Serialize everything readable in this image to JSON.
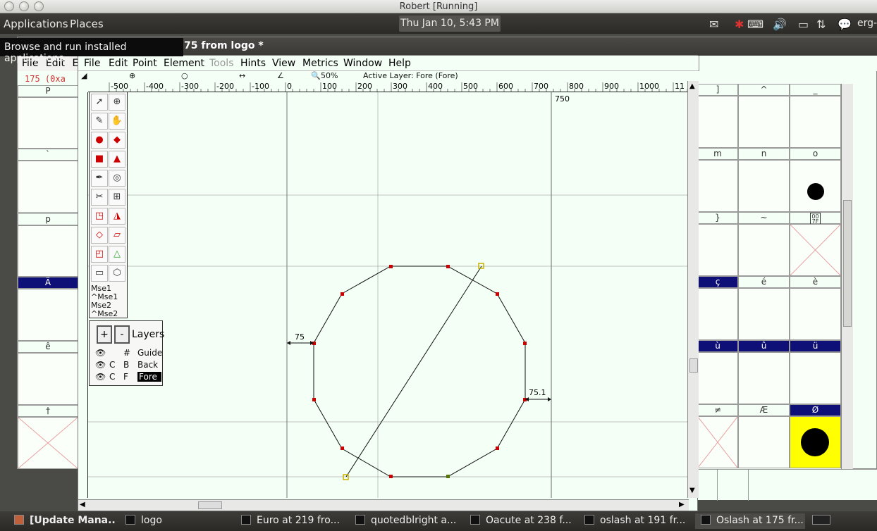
{
  "window_title": "Robert [Running]",
  "panel": {
    "applications": "Applications",
    "places": "Places",
    "clock": "Thu Jan 10,  5:43 PM",
    "user": "erg-"
  },
  "tooltip": "Browse and run installed applications",
  "fontview": {
    "title": "75 from logo *",
    "menu": [
      "File",
      "Edit",
      "E"
    ],
    "glyph_info": "175 (0xa",
    "left_cells": [
      "P",
      "`",
      "p",
      "Ä",
      "ê",
      "†"
    ],
    "right_headers": [
      [
        "]",
        "^",
        "_"
      ],
      [
        "m",
        "n",
        "o"
      ],
      [
        "}",
        "~",
        ""
      ],
      [
        "ç",
        "é",
        "è"
      ],
      [
        "ù",
        "û",
        "ü"
      ],
      [
        "≠",
        "Æ",
        "Ø"
      ]
    ]
  },
  "glyph_editor": {
    "menu": [
      "File",
      "Edit",
      "Point",
      "Element",
      "Tools",
      "Hints",
      "View",
      "Metrics",
      "Window",
      "Help"
    ],
    "zoom": "50%",
    "active_layer": "Active Layer: Fore (Fore)",
    "ruler_labels": [
      "-500",
      "-400",
      "-300",
      "-200",
      "-100",
      "0",
      "100",
      "200",
      "300",
      "400",
      "500",
      "600",
      "700",
      "800",
      "900",
      "1000",
      "11"
    ],
    "advance_label": "750",
    "left_bearing": "75",
    "right_bearing": "75.1",
    "mouse": [
      "Mse1",
      "^Mse1",
      "Mse2",
      "^Mse2"
    ],
    "layers_title": "Layers",
    "layers": [
      {
        "cubic": "",
        "code": "#",
        "name": "Guide"
      },
      {
        "cubic": "C",
        "code": "B",
        "name": "Back"
      },
      {
        "cubic": "C",
        "code": "F",
        "name": "Fore"
      }
    ]
  },
  "taskbar": [
    "[Update Mana...",
    "logo",
    "Euro at 219 fro...",
    "quotedblright a...",
    "Oacute at 238 f...",
    "oslash at 191 fr...",
    "Oslash at 175 fr..."
  ],
  "colors": {
    "canvas": "#f4fff6",
    "point": "#cc0000",
    "selection": "#0f0f78",
    "highlight": "#ffff00"
  }
}
